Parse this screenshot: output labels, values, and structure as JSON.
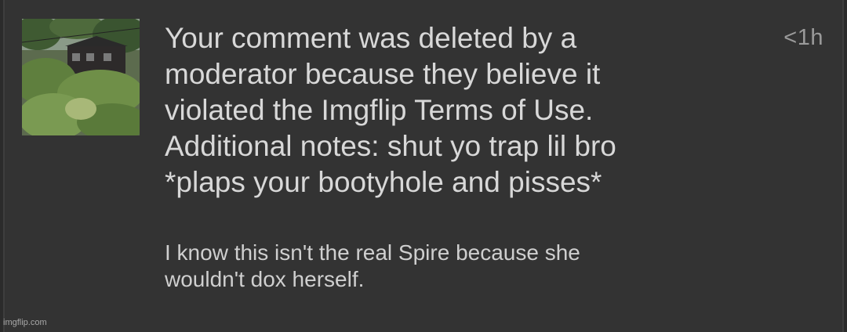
{
  "notification": {
    "timestamp": "<1h",
    "message": "Your comment was deleted by a\nmoderator because they believe it\nviolated the Imgflip Terms of Use.\nAdditional notes: shut yo trap lil bro\n*plaps your bootyhole and pisses*",
    "reply": "I know this isn't the real Spire because she\nwouldn't dox herself.",
    "thumbnail_icon": "house-photo"
  },
  "watermark": "imgflip.com",
  "colors": {
    "background": "#333333",
    "text": "#d8d8d8",
    "muted": "#9a9a9a"
  }
}
